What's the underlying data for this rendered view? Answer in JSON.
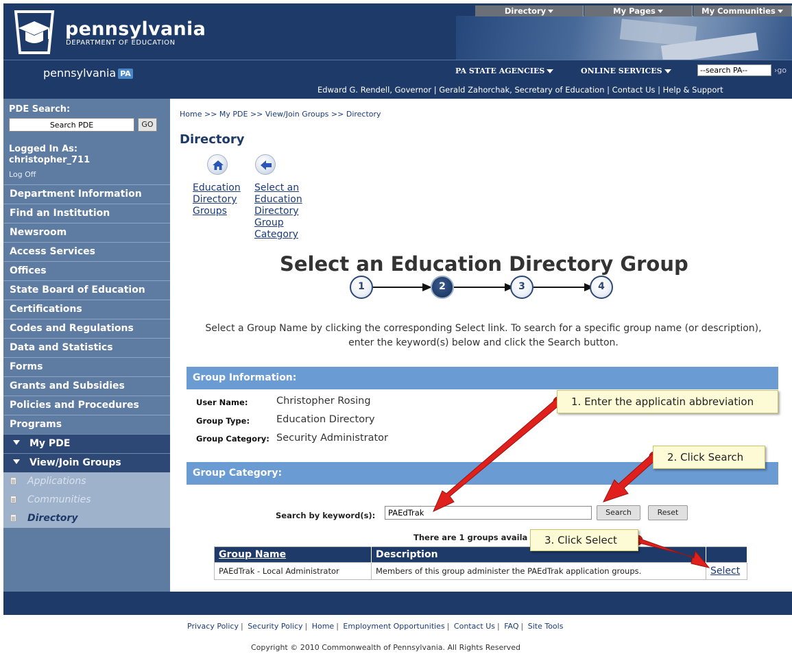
{
  "header": {
    "logo_title": "pennsylvania",
    "logo_subtitle": "DEPARTMENT OF EDUCATION",
    "menus": [
      "Directory",
      "My Pages",
      "My Communities"
    ]
  },
  "subbar": {
    "brand": "pennsylvania",
    "brand_badge": "PA",
    "agencies_label": "PA STATE AGENCIES",
    "online_services_label": "ONLINE SERVICES",
    "search_value": "--search PA--",
    "go_label": "go",
    "governor_line": "Edward G. Rendell, Governor | Gerald Zahorchak, Secretary of Education | Contact Us | Help & Support"
  },
  "sidebar": {
    "search_label": "PDE Search:",
    "search_value": "Search PDE",
    "go_label": "GO",
    "logged_in_label": "Logged In As:",
    "username": "christopher_711",
    "logoff_label": "Log Off",
    "nav_items": [
      "Department Information",
      "Find an Institution",
      "Newsroom",
      "Access Services",
      "Offices",
      "State Board of Education",
      "Certifications",
      "Codes and Regulations",
      "Data and Statistics",
      "Forms",
      "Grants and Subsidies",
      "Policies and Procedures",
      "Programs"
    ],
    "expanded_items": [
      "My PDE",
      "View/Join Groups"
    ],
    "sub_items": [
      "Applications",
      "Communities",
      "Directory"
    ]
  },
  "content": {
    "breadcrumb": "Home >> My PDE >> View/Join Groups >> Directory",
    "page_title": "Directory",
    "nav_link_home": "Education Directory Groups",
    "nav_link_back": "Select an Education Directory Group Category",
    "heading": "Select an Education Directory Group",
    "steps": [
      "1",
      "2",
      "3",
      "4"
    ],
    "current_step": 2,
    "instructions": "Select a Group Name by clicking the corresponding Select link.  To search for a specific group name (or description), enter the keyword(s) below and click the Search button.",
    "group_info_title": "Group Information:",
    "info": [
      {
        "label": "User Name:",
        "value": "Christopher Rosing"
      },
      {
        "label": "Group Type:",
        "value": "Education Directory"
      },
      {
        "label": "Group Category:",
        "value": "Security Administrator"
      }
    ],
    "group_category_title": "Group Category:",
    "keyword_label": "Search by keyword(s):",
    "keyword_value": "PAEdTrak",
    "search_button": "Search",
    "reset_button": "Reset",
    "groups_count_text": "There are 1 groups availa",
    "table": {
      "headers": [
        "Group Name",
        "Description",
        ""
      ],
      "rows": [
        {
          "name": "PAEdTrak - Local Administrator",
          "description": "Members of this group administer the PAEdTrak application groups.",
          "action": "Select"
        }
      ]
    }
  },
  "callouts": [
    "1.  Enter the applicatin abbreviation",
    "2. Click Search",
    "3. Click Select"
  ],
  "colors": {
    "navy": "#1e3a68",
    "sidebar": "#5e7ba2",
    "section_bar": "#6a9bd3",
    "callout_bg": "#fdfbd6",
    "annotation_arrow": "#e0201c"
  },
  "footer": {
    "links": [
      "Privacy Policy",
      "Security Policy",
      "Home",
      "Employment Opportunities",
      "Contact Us",
      "FAQ",
      "Site Tools"
    ],
    "copyright": "Copyright © 2010 Commonwealth of Pennsylvania. All Rights Reserved"
  }
}
